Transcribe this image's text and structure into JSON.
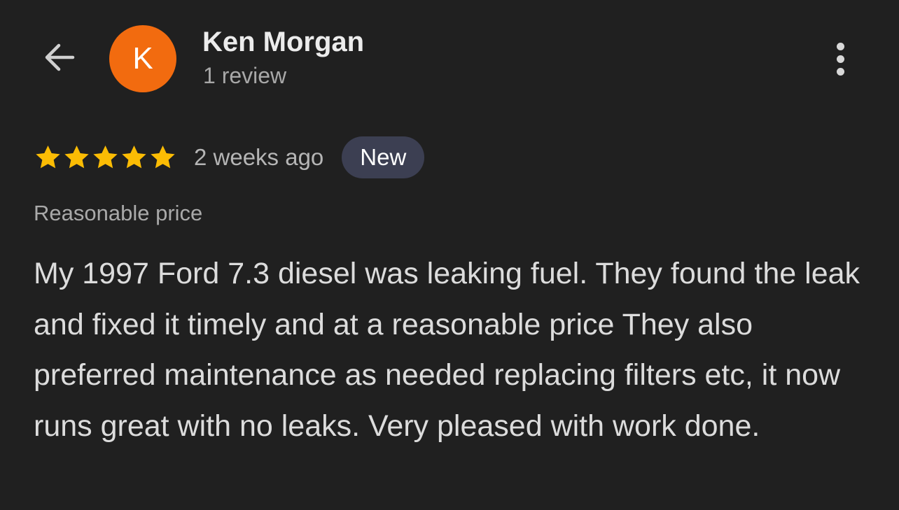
{
  "header": {
    "back_icon": "arrow-left-icon",
    "avatar": {
      "initial": "K",
      "color": "#f26b0f"
    },
    "author_name": "Ken Morgan",
    "review_count": "1 review",
    "more_icon": "more-vertical-icon"
  },
  "review": {
    "rating": 5,
    "rating_max": 5,
    "star_color": "#fbbc04",
    "time_ago": "2 weeks ago",
    "badge": {
      "label": "New",
      "bg_color": "#3c3f52"
    },
    "tag": "Reasonable price",
    "text": "My 1997 Ford 7.3 diesel was leaking fuel. They found the leak and fixed it timely and at a reasonable price They also preferred maintenance as needed replacing filters etc, it now runs great with no leaks. Very pleased with work done."
  }
}
